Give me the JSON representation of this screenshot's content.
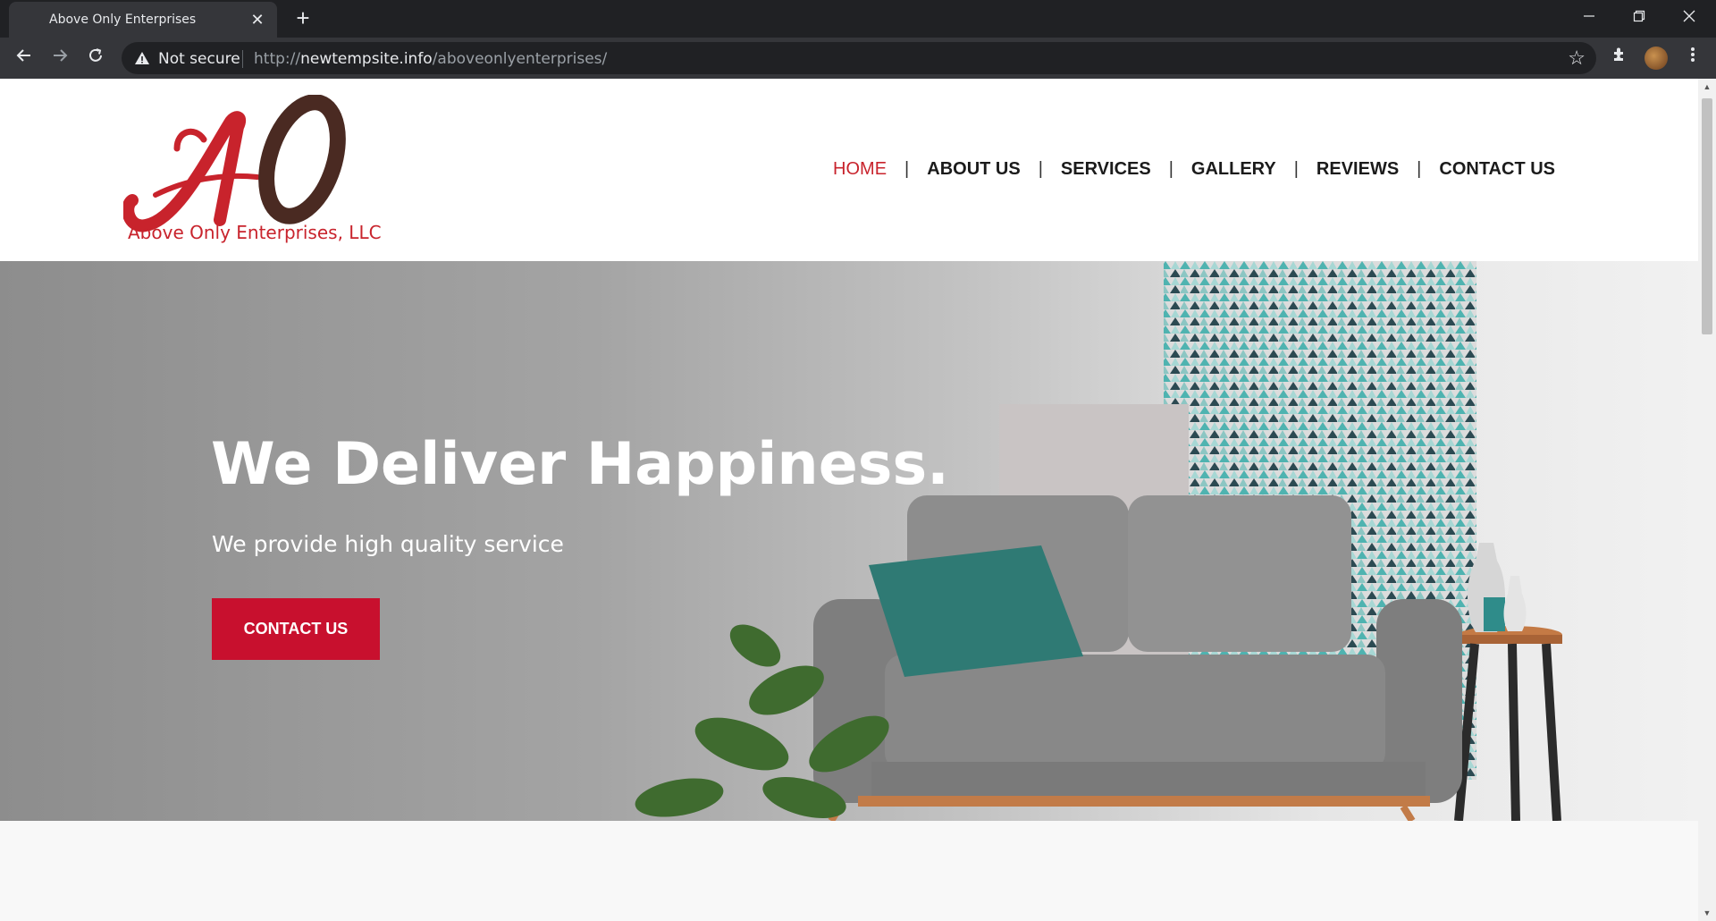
{
  "browser": {
    "tab_title": "Above Only Enterprises",
    "tab_close": "✕",
    "new_tab": "+",
    "security_label": "Not secure",
    "url_scheme": "http://",
    "url_host": "newtempsite.info",
    "url_path": "/aboveonlyenterprises/",
    "icons": [
      "back-icon",
      "forward-icon",
      "reload-icon",
      "warning-icon",
      "star-icon",
      "extensions-icon",
      "avatar",
      "menu-icon",
      "minimize-icon",
      "restore-icon",
      "close-icon"
    ]
  },
  "site": {
    "logo_text": "Above Only Enterprises, LLC",
    "brand_colors": {
      "red": "#c8232c",
      "brown": "#4a2a22",
      "button": "#c8102e"
    },
    "nav": [
      {
        "label": "HOME",
        "active": true
      },
      {
        "label": "ABOUT US",
        "active": false
      },
      {
        "label": "SERVICES",
        "active": false
      },
      {
        "label": "GALLERY",
        "active": false
      },
      {
        "label": "REVIEWS",
        "active": false
      },
      {
        "label": "CONTACT US",
        "active": false
      }
    ],
    "nav_separator": "|",
    "hero": {
      "title": "We Deliver Happiness.",
      "subtitle": "We provide high quality service",
      "button_label": "CONTACT US"
    }
  }
}
